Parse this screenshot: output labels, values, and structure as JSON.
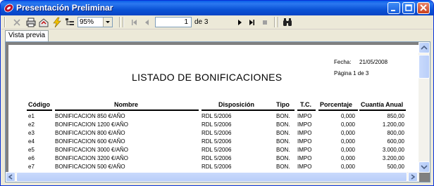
{
  "window": {
    "title": "Presentación Preliminar"
  },
  "toolbar": {
    "zoom_value": "95%",
    "page_current": "1",
    "page_of": "de 3"
  },
  "tabs": [
    {
      "label": "Vista previa"
    }
  ],
  "report": {
    "title": "LISTADO DE BONIFICACIONES",
    "fecha_label": "Fecha:",
    "fecha_value": "21/05/2008",
    "page_label": "Página 1 de 3",
    "columns": [
      "Código",
      "Nombre",
      "Disposición",
      "Tipo",
      "T.C.",
      "Porcentaje",
      "Cuantía Anual"
    ],
    "rows": [
      [
        "e1",
        "BONIFICACION 850 €/AÑO",
        "RDL 5/2006",
        "BON.",
        "IMPO",
        "0,000",
        "850,00"
      ],
      [
        "e2",
        "BONIFICACION 1200 €/AÑO",
        "RDL 5/2006",
        "BON.",
        "IMPO",
        "0,000",
        "1.200,00"
      ],
      [
        "e3",
        "BONIFICACION 800 €/AÑO",
        "RDL 5/2006",
        "BON.",
        "IMPO",
        "0,000",
        "800,00"
      ],
      [
        "e4",
        "BONIFICACION 600 €/AÑO",
        "RDL 5/2006",
        "BON.",
        "IMPO",
        "0,000",
        "600,00"
      ],
      [
        "e5",
        "BONIFICACION 3000 €/AÑO",
        "RDL 5/2006",
        "BON.",
        "IMPO",
        "0,000",
        "3.000,00"
      ],
      [
        "e6",
        "BONIFICACION 3200 €/AÑO",
        "RDL 5/2006",
        "BON.",
        "IMPO",
        "0,000",
        "3.200,00"
      ],
      [
        "e7",
        "BONIFICACION 500 €/AÑO",
        "RDL 5/2006",
        "BON.",
        "IMPO",
        "0,000",
        "500,00"
      ]
    ]
  }
}
